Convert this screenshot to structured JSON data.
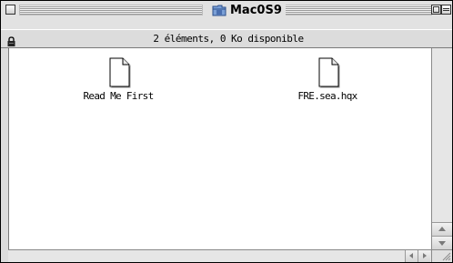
{
  "window": {
    "title": "Mac0S9",
    "title_icon": "folder-icon",
    "status_text": "2 éléments, 0  Ko disponible",
    "status_icon": "lock-icon"
  },
  "files": [
    {
      "name": "Read Me First",
      "icon": "document-icon"
    },
    {
      "name": "FRE.sea.hqx",
      "icon": "document-icon"
    }
  ],
  "colors": {
    "window_bg": "#dedede",
    "content_bg": "#ffffff",
    "folder_blue": "#5a7fb8"
  }
}
